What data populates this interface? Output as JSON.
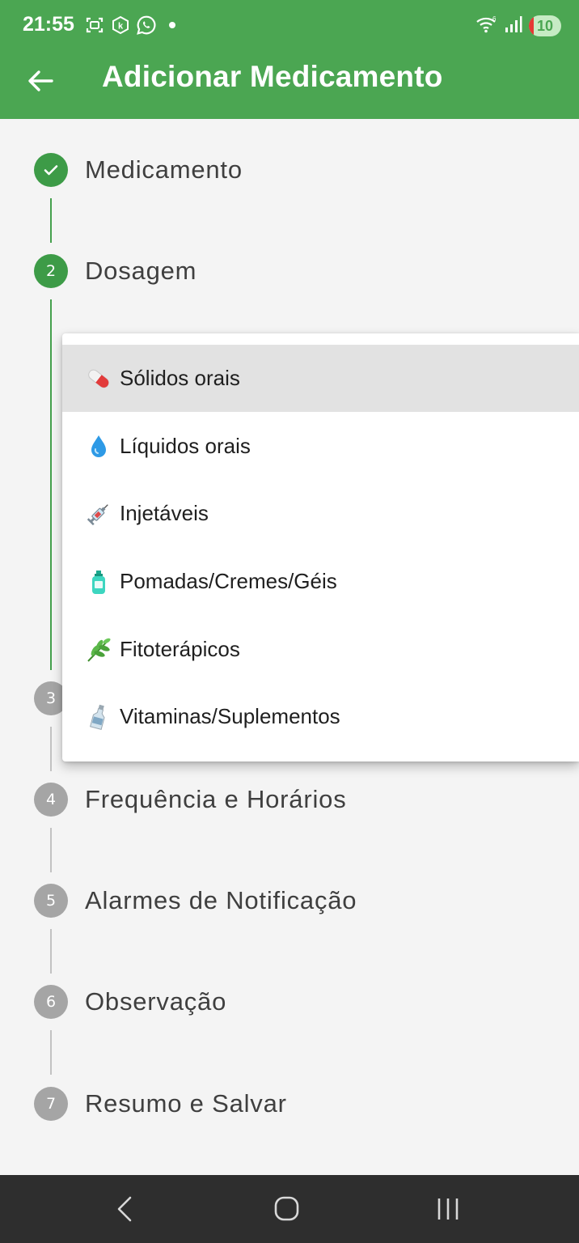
{
  "status_bar": {
    "time": "21:55",
    "battery": "10",
    "left_icons": [
      "screenshot-icon",
      "k-app-icon",
      "whatsapp-icon",
      "dot-icon"
    ],
    "right_icons": [
      "wifi-icon",
      "signal-icon",
      "battery-icon"
    ]
  },
  "app_bar": {
    "title": "Adicionar Medicamento",
    "back_icon": "arrow-left-icon",
    "color": "#4ba652"
  },
  "stepper": {
    "steps": [
      {
        "number": "",
        "label": "Medicamento",
        "state": "completed"
      },
      {
        "number": "2",
        "label": "Dosagem",
        "state": "active"
      },
      {
        "number": "3",
        "label": "",
        "state": "inactive"
      },
      {
        "number": "4",
        "label": "Frequência e Horários",
        "state": "inactive"
      },
      {
        "number": "5",
        "label": "Alarmes de Notificação",
        "state": "inactive"
      },
      {
        "number": "6",
        "label": "Observação",
        "state": "inactive"
      },
      {
        "number": "7",
        "label": "Resumo e Salvar",
        "state": "inactive"
      }
    ],
    "active_color": "#3d9b47",
    "inactive_color": "#a5a5a5"
  },
  "dropdown_menu": {
    "options": [
      {
        "icon": "pill-icon",
        "label": "Sólidos orais",
        "selected": true
      },
      {
        "icon": "droplet-icon",
        "label": "Líquidos orais",
        "selected": false
      },
      {
        "icon": "syringe-icon",
        "label": "Injetáveis",
        "selected": false
      },
      {
        "icon": "lotion-bottle-icon",
        "label": "Pomadas/Cremes/Géis",
        "selected": false
      },
      {
        "icon": "herb-icon",
        "label": "Fitoterápicos",
        "selected": false
      },
      {
        "icon": "supplement-bottle-icon",
        "label": "Vitaminas/Suplementos",
        "selected": false
      }
    ]
  },
  "nav_bar": {
    "buttons": [
      "back-nav-icon",
      "home-nav-icon",
      "recents-nav-icon"
    ]
  }
}
